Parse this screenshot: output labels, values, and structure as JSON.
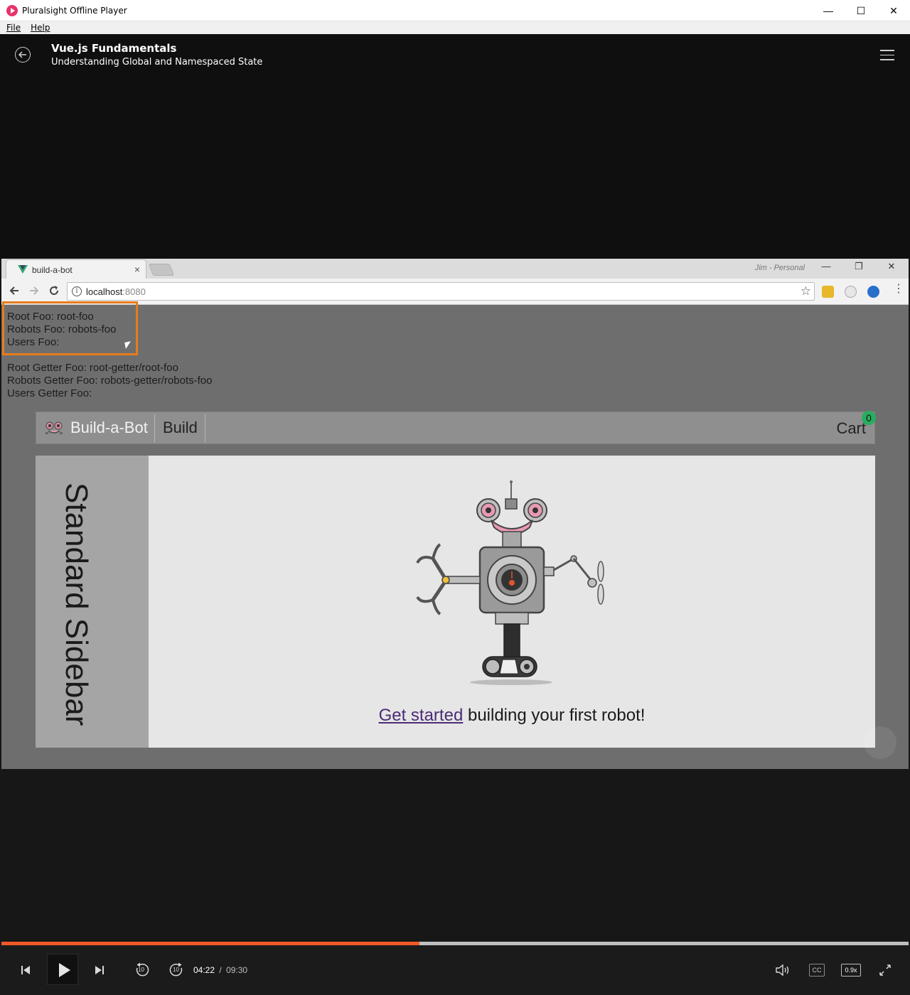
{
  "window": {
    "title": "Pluralsight Offline Player",
    "minimize": "—",
    "maximize": "☐",
    "close": "✕"
  },
  "menu": {
    "file": "File",
    "help": "Help"
  },
  "header": {
    "course_title": "Vue.js Fundamentals",
    "module_title": "Understanding Global and Namespaced State"
  },
  "browser": {
    "tab_title": "build-a-bot",
    "tab_close": "×",
    "profile": "Jim - Personal",
    "url_host": "localhost",
    "url_port": ":8080",
    "min": "—",
    "restore": "❐",
    "close": "✕"
  },
  "page": {
    "state_lines": [
      "Root Foo: root-foo",
      "Robots Foo: robots-foo",
      "Users Foo:"
    ],
    "getter_lines": [
      "Root Getter Foo: root-getter/root-foo",
      "Robots Getter Foo: robots-getter/robots-foo",
      "Users Getter Foo:"
    ],
    "nav": {
      "brand": "Build-a-Bot",
      "build": "Build",
      "cart": "Cart",
      "cart_count": "0"
    },
    "sidebar_text": "Standard Sidebar",
    "cta_link": "Get started",
    "cta_rest": " building your first robot!"
  },
  "player": {
    "current_time": "04:22",
    "separator": "/",
    "duration": "09:30",
    "progress": 0.461,
    "skip_back_label": "10",
    "skip_fwd_label": "10",
    "cc_label": "CC",
    "speed_label": "0.9x"
  },
  "colors": {
    "progress": "#f05a28",
    "highlight": "#e77c1c",
    "brand_icon": "#e8336a",
    "cart_badge": "#27ae60",
    "link": "#4b2c75"
  }
}
